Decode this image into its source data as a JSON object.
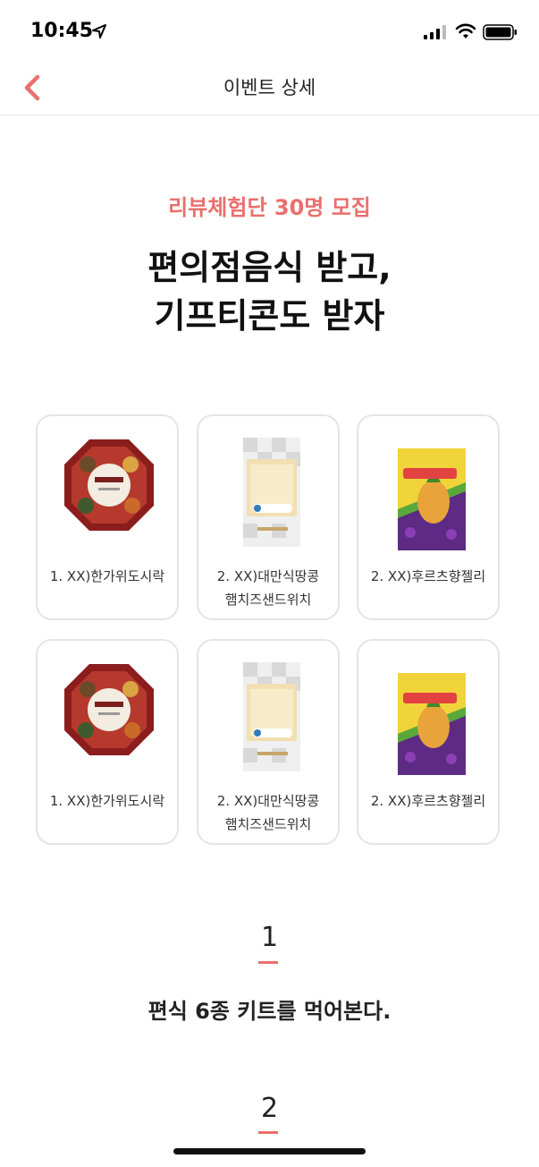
{
  "status_bar": {
    "time": "10:45"
  },
  "header": {
    "title": "이벤트 상세"
  },
  "event": {
    "subtitle": "리뷰체험단 30명 모집",
    "headline_line1": "편의점음식 받고,",
    "headline_line2": "기프티콘도 받자"
  },
  "products": [
    {
      "line1": "1. XX)한가위도시락",
      "line2": ""
    },
    {
      "line1": "2. XX)대만식땅콩",
      "line2": "햄치즈샌드위치"
    },
    {
      "line1": "2. XX)후르츠향젤리",
      "line2": ""
    },
    {
      "line1": "1. XX)한가위도시락",
      "line2": ""
    },
    {
      "line1": "2. XX)대만식땅콩",
      "line2": "햄치즈샌드위치"
    },
    {
      "line1": "2. XX)후르츠향젤리",
      "line2": ""
    }
  ],
  "steps": [
    {
      "number": "1",
      "text": "편식 6종 키트를 먹어본다."
    },
    {
      "number": "2",
      "text": ""
    }
  ],
  "colors": {
    "accent": "#e9706d",
    "card_border": "#e4e4e4"
  }
}
